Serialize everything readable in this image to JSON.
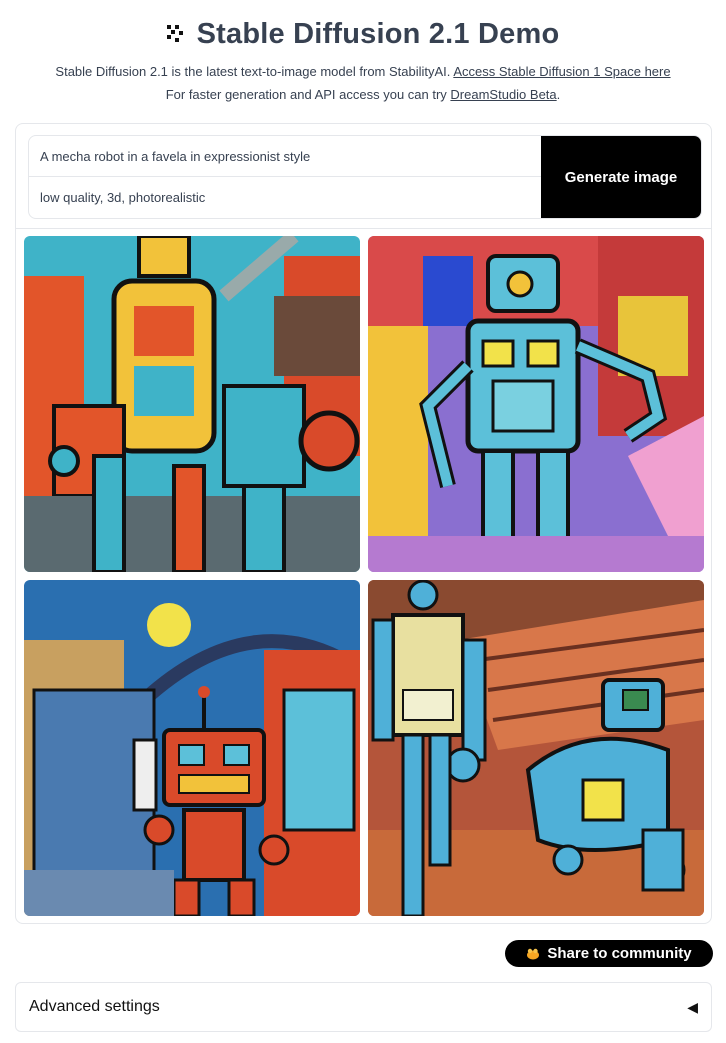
{
  "header": {
    "title": "Stable Diffusion 2.1 Demo",
    "line1_text": "Stable Diffusion 2.1 is the latest text-to-image model from StabilityAI.",
    "line1_link": "Access Stable Diffusion 1 Space here",
    "line2_text": "For faster generation and API access you can try",
    "line2_link": "DreamStudio Beta",
    "line2_end": "."
  },
  "form": {
    "prompt": "A mecha robot in a favela in expressionist style",
    "negative_prompt": "low quality, 3d, photorealistic",
    "generate_label": "Generate image"
  },
  "gallery": {
    "images": [
      {
        "subject": "mecha robot, expressionist",
        "palette": [
          "#e2552a",
          "#3fb3c8",
          "#f2c23a"
        ]
      },
      {
        "subject": "mecha robot, expressionist",
        "palette": [
          "#c43a3a",
          "#5cc0d9",
          "#8a6fd0"
        ]
      },
      {
        "subject": "mecha robot, expressionist",
        "palette": [
          "#2a6fb0",
          "#d94a2a",
          "#f2e24a"
        ]
      },
      {
        "subject": "mecha robot, expressionist",
        "palette": [
          "#b4553a",
          "#4fb0d8",
          "#e08a3a"
        ]
      }
    ]
  },
  "share": {
    "label": "Share to community",
    "icon": "share-hands-icon"
  },
  "advanced": {
    "label": "Advanced settings",
    "caret": "◀"
  }
}
